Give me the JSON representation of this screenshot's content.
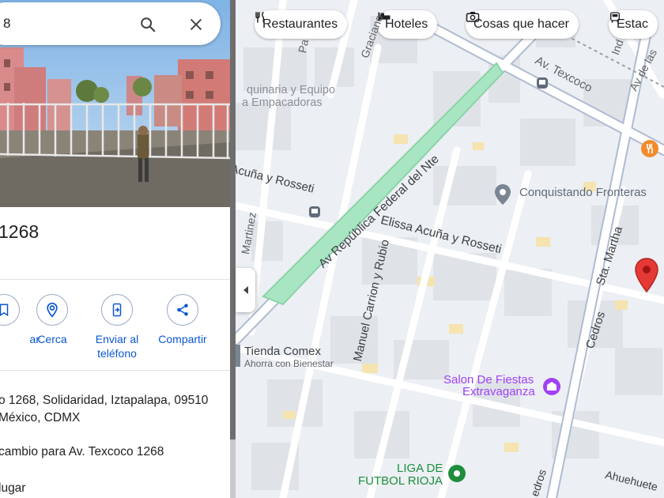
{
  "search": {
    "query_fragment": "8"
  },
  "place": {
    "title_fragment": "1268"
  },
  "actions": [
    {
      "label": "ar"
    },
    {
      "label": "Cerca"
    },
    {
      "label_line1": "Enviar al",
      "label_line2": "teléfono"
    },
    {
      "label": "Compartir"
    }
  ],
  "info": {
    "address_line1": "o 1268, Solidaridad, Iztapalapa, 09510",
    "address_line2": "México, CDMX",
    "suggest_edit": "cambio para Av. Texcoco 1268",
    "add_place": "lugar"
  },
  "map_chips": [
    {
      "label": "Restaurantes",
      "icon": "fork-knife-icon"
    },
    {
      "label": "Hoteles",
      "icon": "bed-icon"
    },
    {
      "label": "Cosas que hacer",
      "icon": "camera-icon"
    },
    {
      "label": "Estac",
      "icon": "transit-icon"
    }
  ],
  "map_labels": {
    "maquinaria_1": "quinaria y Equipo",
    "maquinaria_2": "a Empacadoras",
    "graciano": "Graciano",
    "av_texcoco": "Av. Texcoco",
    "pa": "Pa",
    "av_de_las": "Av de las",
    "ind": "Ind",
    "acuna_rosseti_left": "Acuña y Rosseti",
    "martinez": "Martinez",
    "av_republica": "Av República Federal del Nte",
    "elissa": "Elissa Acuña y Rosseti",
    "manuel_carrion": "Manuel Carrion y Rubio",
    "conquistando": "Conquistando Fronteras",
    "sta_martha": "Sta. Martha",
    "cedros": "Cedros",
    "tienda_1": "Tienda Comex",
    "tienda_2": "Ahorra con Bienestar",
    "salon_1": "Salon De Fiestas",
    "salon_2": "Extravaganza",
    "liga_1": "LIGA DE",
    "liga_2": "FUTBOL RIOJA",
    "ahuehuetes": "Ahuehuete",
    "cedros_bottom": "edros"
  },
  "colors": {
    "accent": "#0b57d0",
    "park": "#a8e6c3",
    "marker": "#e53935",
    "poi_blue": "#5f6b7a",
    "poi_purple": "#a142f4",
    "poi_green": "#1e8e3e",
    "poi_orange": "#f28b2b"
  }
}
